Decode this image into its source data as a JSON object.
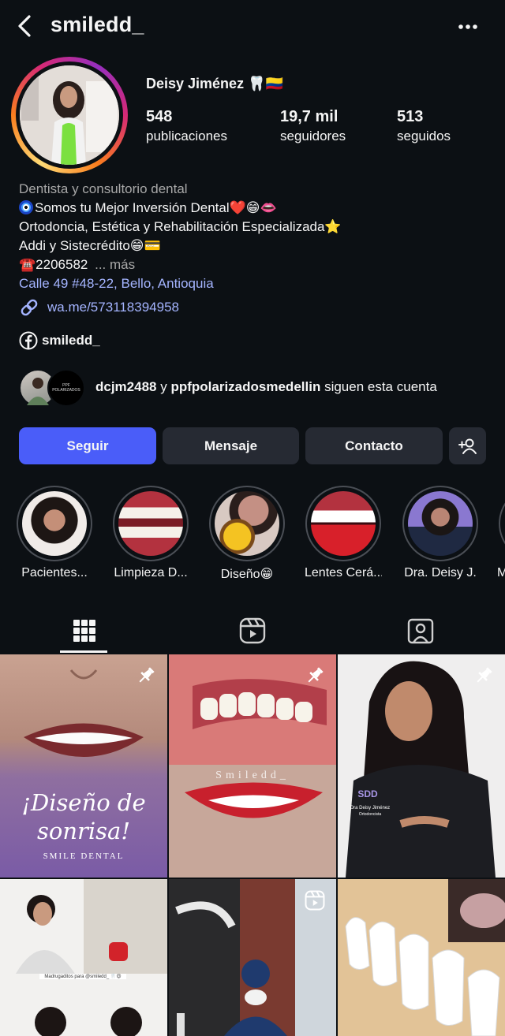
{
  "header": {
    "username": "smiledd_"
  },
  "profile": {
    "full_name": "Deisy Jiménez 🦷🇨🇴",
    "stats": [
      {
        "value": "548",
        "label": "publicaciones"
      },
      {
        "value": "19,7 mil",
        "label": "seguidores"
      },
      {
        "value": "513",
        "label": "seguidos"
      }
    ],
    "category": "Dentista y consultorio dental",
    "bio_lines": [
      "Somos tu Mejor Inversión Dental❤️😁👄",
      "Ortodoncia, Estética y Rehabilitación Especializada⭐",
      "Addi y Sistecrédito😁💳",
      "☎️2206582"
    ],
    "more_label": "... más",
    "address": "Calle 49 #48-22, Bello, Antioquia",
    "website": "wa.me/573118394958",
    "facebook": "smiledd_"
  },
  "followed_by": {
    "user1": "dcjm2488",
    "joiner": "y",
    "user2": "ppfpolarizadosmedellin",
    "suffix": "siguen esta cuenta",
    "avatar2_text": "PPF POLARIZADOS"
  },
  "actions": {
    "follow": "Seguir",
    "message": "Mensaje",
    "contact": "Contacto"
  },
  "highlights": [
    {
      "label": "Pacientes..."
    },
    {
      "label": "Limpieza D..."
    },
    {
      "label": "Diseño😁"
    },
    {
      "label": "Lentes Cerá..."
    },
    {
      "label": "Dra. Deisy J."
    },
    {
      "label": "M"
    }
  ],
  "posts": {
    "post1_title": "¡Diseño de sonrisa!",
    "post1_brand": "SMILE DENTAL",
    "post2_watermark": "Smiledd_",
    "post3_logo": "SDD",
    "post3_name": "Dra Deisy Jiménez",
    "post3_role": "Ortodoncista",
    "post4_caption": "Madrugaditos para @smiledd_ 🦷😍"
  },
  "colors": {
    "background": "#0c1014",
    "primary_button": "#4a5df9",
    "secondary_button": "#262a33",
    "link": "#a4b4ff"
  }
}
